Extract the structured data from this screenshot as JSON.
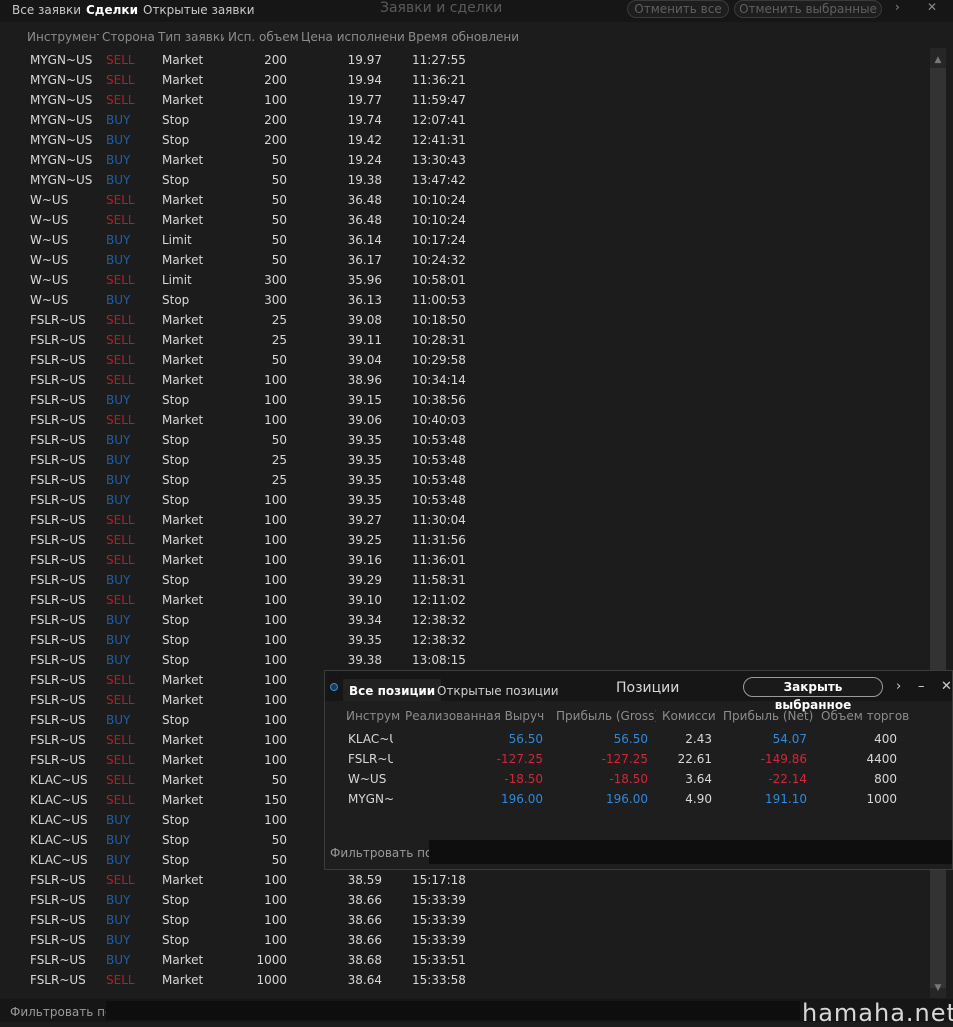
{
  "top": {
    "tabs": [
      "Все заявки",
      "Сделки",
      "Открытые заявки"
    ],
    "title": "Заявки и сделки",
    "cancel_all": "Отменить все",
    "cancel_selected": "Отменить выбранные",
    "more_icon": "›",
    "close_icon": "✕"
  },
  "columns": [
    "Инструмент",
    "Сторона",
    "Тип заявки",
    "Исп. объем",
    "Цена исполнения",
    "Время обновления"
  ],
  "trades": [
    {
      "inst": "MYGN~US",
      "side": "SELL",
      "type": "Market",
      "qty": "200",
      "price": "19.97",
      "time": "11:27:55"
    },
    {
      "inst": "MYGN~US",
      "side": "SELL",
      "type": "Market",
      "qty": "200",
      "price": "19.94",
      "time": "11:36:21"
    },
    {
      "inst": "MYGN~US",
      "side": "SELL",
      "type": "Market",
      "qty": "100",
      "price": "19.77",
      "time": "11:59:47"
    },
    {
      "inst": "MYGN~US",
      "side": "BUY",
      "type": "Stop",
      "qty": "200",
      "price": "19.74",
      "time": "12:07:41"
    },
    {
      "inst": "MYGN~US",
      "side": "BUY",
      "type": "Stop",
      "qty": "200",
      "price": "19.42",
      "time": "12:41:31"
    },
    {
      "inst": "MYGN~US",
      "side": "BUY",
      "type": "Market",
      "qty": "50",
      "price": "19.24",
      "time": "13:30:43"
    },
    {
      "inst": "MYGN~US",
      "side": "BUY",
      "type": "Stop",
      "qty": "50",
      "price": "19.38",
      "time": "13:47:42"
    },
    {
      "inst": "W~US",
      "side": "SELL",
      "type": "Market",
      "qty": "50",
      "price": "36.48",
      "time": "10:10:24"
    },
    {
      "inst": "W~US",
      "side": "SELL",
      "type": "Market",
      "qty": "50",
      "price": "36.48",
      "time": "10:10:24"
    },
    {
      "inst": "W~US",
      "side": "BUY",
      "type": "Limit",
      "qty": "50",
      "price": "36.14",
      "time": "10:17:24"
    },
    {
      "inst": "W~US",
      "side": "BUY",
      "type": "Market",
      "qty": "50",
      "price": "36.17",
      "time": "10:24:32"
    },
    {
      "inst": "W~US",
      "side": "SELL",
      "type": "Limit",
      "qty": "300",
      "price": "35.96",
      "time": "10:58:01"
    },
    {
      "inst": "W~US",
      "side": "BUY",
      "type": "Stop",
      "qty": "300",
      "price": "36.13",
      "time": "11:00:53"
    },
    {
      "inst": "FSLR~US",
      "side": "SELL",
      "type": "Market",
      "qty": "25",
      "price": "39.08",
      "time": "10:18:50"
    },
    {
      "inst": "FSLR~US",
      "side": "SELL",
      "type": "Market",
      "qty": "25",
      "price": "39.11",
      "time": "10:28:31"
    },
    {
      "inst": "FSLR~US",
      "side": "SELL",
      "type": "Market",
      "qty": "50",
      "price": "39.04",
      "time": "10:29:58"
    },
    {
      "inst": "FSLR~US",
      "side": "SELL",
      "type": "Market",
      "qty": "100",
      "price": "38.96",
      "time": "10:34:14"
    },
    {
      "inst": "FSLR~US",
      "side": "BUY",
      "type": "Stop",
      "qty": "100",
      "price": "39.15",
      "time": "10:38:56"
    },
    {
      "inst": "FSLR~US",
      "side": "SELL",
      "type": "Market",
      "qty": "100",
      "price": "39.06",
      "time": "10:40:03"
    },
    {
      "inst": "FSLR~US",
      "side": "BUY",
      "type": "Stop",
      "qty": "50",
      "price": "39.35",
      "time": "10:53:48"
    },
    {
      "inst": "FSLR~US",
      "side": "BUY",
      "type": "Stop",
      "qty": "25",
      "price": "39.35",
      "time": "10:53:48"
    },
    {
      "inst": "FSLR~US",
      "side": "BUY",
      "type": "Stop",
      "qty": "25",
      "price": "39.35",
      "time": "10:53:48"
    },
    {
      "inst": "FSLR~US",
      "side": "BUY",
      "type": "Stop",
      "qty": "100",
      "price": "39.35",
      "time": "10:53:48"
    },
    {
      "inst": "FSLR~US",
      "side": "SELL",
      "type": "Market",
      "qty": "100",
      "price": "39.27",
      "time": "11:30:04"
    },
    {
      "inst": "FSLR~US",
      "side": "SELL",
      "type": "Market",
      "qty": "100",
      "price": "39.25",
      "time": "11:31:56"
    },
    {
      "inst": "FSLR~US",
      "side": "SELL",
      "type": "Market",
      "qty": "100",
      "price": "39.16",
      "time": "11:36:01"
    },
    {
      "inst": "FSLR~US",
      "side": "BUY",
      "type": "Stop",
      "qty": "100",
      "price": "39.29",
      "time": "11:58:31"
    },
    {
      "inst": "FSLR~US",
      "side": "SELL",
      "type": "Market",
      "qty": "100",
      "price": "39.10",
      "time": "12:11:02"
    },
    {
      "inst": "FSLR~US",
      "side": "BUY",
      "type": "Stop",
      "qty": "100",
      "price": "39.34",
      "time": "12:38:32"
    },
    {
      "inst": "FSLR~US",
      "side": "BUY",
      "type": "Stop",
      "qty": "100",
      "price": "39.35",
      "time": "12:38:32"
    },
    {
      "inst": "FSLR~US",
      "side": "BUY",
      "type": "Stop",
      "qty": "100",
      "price": "39.38",
      "time": "13:08:15"
    },
    {
      "inst": "FSLR~US",
      "side": "SELL",
      "type": "Market",
      "qty": "100",
      "price": "",
      "time": ""
    },
    {
      "inst": "FSLR~US",
      "side": "SELL",
      "type": "Market",
      "qty": "100",
      "price": "",
      "time": ""
    },
    {
      "inst": "FSLR~US",
      "side": "BUY",
      "type": "Stop",
      "qty": "100",
      "price": "",
      "time": ""
    },
    {
      "inst": "FSLR~US",
      "side": "SELL",
      "type": "Market",
      "qty": "100",
      "price": "",
      "time": ""
    },
    {
      "inst": "FSLR~US",
      "side": "SELL",
      "type": "Market",
      "qty": "100",
      "price": "",
      "time": ""
    },
    {
      "inst": "KLAC~US",
      "side": "SELL",
      "type": "Market",
      "qty": "50",
      "price": "",
      "time": ""
    },
    {
      "inst": "KLAC~US",
      "side": "SELL",
      "type": "Market",
      "qty": "150",
      "price": "",
      "time": ""
    },
    {
      "inst": "KLAC~US",
      "side": "BUY",
      "type": "Stop",
      "qty": "100",
      "price": "",
      "time": ""
    },
    {
      "inst": "KLAC~US",
      "side": "BUY",
      "type": "Stop",
      "qty": "50",
      "price": "",
      "time": ""
    },
    {
      "inst": "KLAC~US",
      "side": "BUY",
      "type": "Stop",
      "qty": "50",
      "price": "",
      "time": ""
    },
    {
      "inst": "FSLR~US",
      "side": "SELL",
      "type": "Market",
      "qty": "100",
      "price": "38.59",
      "time": "15:17:18"
    },
    {
      "inst": "FSLR~US",
      "side": "BUY",
      "type": "Stop",
      "qty": "100",
      "price": "38.66",
      "time": "15:33:39"
    },
    {
      "inst": "FSLR~US",
      "side": "BUY",
      "type": "Stop",
      "qty": "100",
      "price": "38.66",
      "time": "15:33:39"
    },
    {
      "inst": "FSLR~US",
      "side": "BUY",
      "type": "Stop",
      "qty": "100",
      "price": "38.66",
      "time": "15:33:39"
    },
    {
      "inst": "FSLR~US",
      "side": "BUY",
      "type": "Market",
      "qty": "1000",
      "price": "38.68",
      "time": "15:33:51"
    },
    {
      "inst": "FSLR~US",
      "side": "SELL",
      "type": "Market",
      "qty": "1000",
      "price": "38.64",
      "time": "15:33:58"
    }
  ],
  "filter_label": "Фильтровать по",
  "watermark": "hamaha.net",
  "positions": {
    "tabs": [
      "Все позиции",
      "Открытые позиции"
    ],
    "title": "Позиции",
    "close_selected": "Закрыть выбранное",
    "more_icon": "›",
    "minimize_icon": "–",
    "close_icon": "✕",
    "columns": [
      "Инструм",
      "Реализованная Выручка",
      "Прибыль (Gross)",
      "Комисси",
      "Прибыль (Net)",
      "Объем торгов"
    ],
    "rows": [
      {
        "inst": "KLAC~US",
        "realized": "56.50",
        "gross": "56.50",
        "comm": "2.43",
        "net": "54.07",
        "volume": "400"
      },
      {
        "inst": "FSLR~US",
        "realized": "-127.25",
        "gross": "-127.25",
        "comm": "22.61",
        "net": "-149.86",
        "volume": "4400"
      },
      {
        "inst": "W~US",
        "realized": "-18.50",
        "gross": "-18.50",
        "comm": "3.64",
        "net": "-22.14",
        "volume": "800"
      },
      {
        "inst": "MYGN~US",
        "realized": "196.00",
        "gross": "196.00",
        "comm": "4.90",
        "net": "191.10",
        "volume": "1000"
      }
    ],
    "filter_label": "Фильтровать по"
  },
  "colors": {
    "sell": "#b51e26",
    "buy": "#1f5fa8",
    "positive": "#2a8ae0",
    "negative": "#d1263a"
  }
}
